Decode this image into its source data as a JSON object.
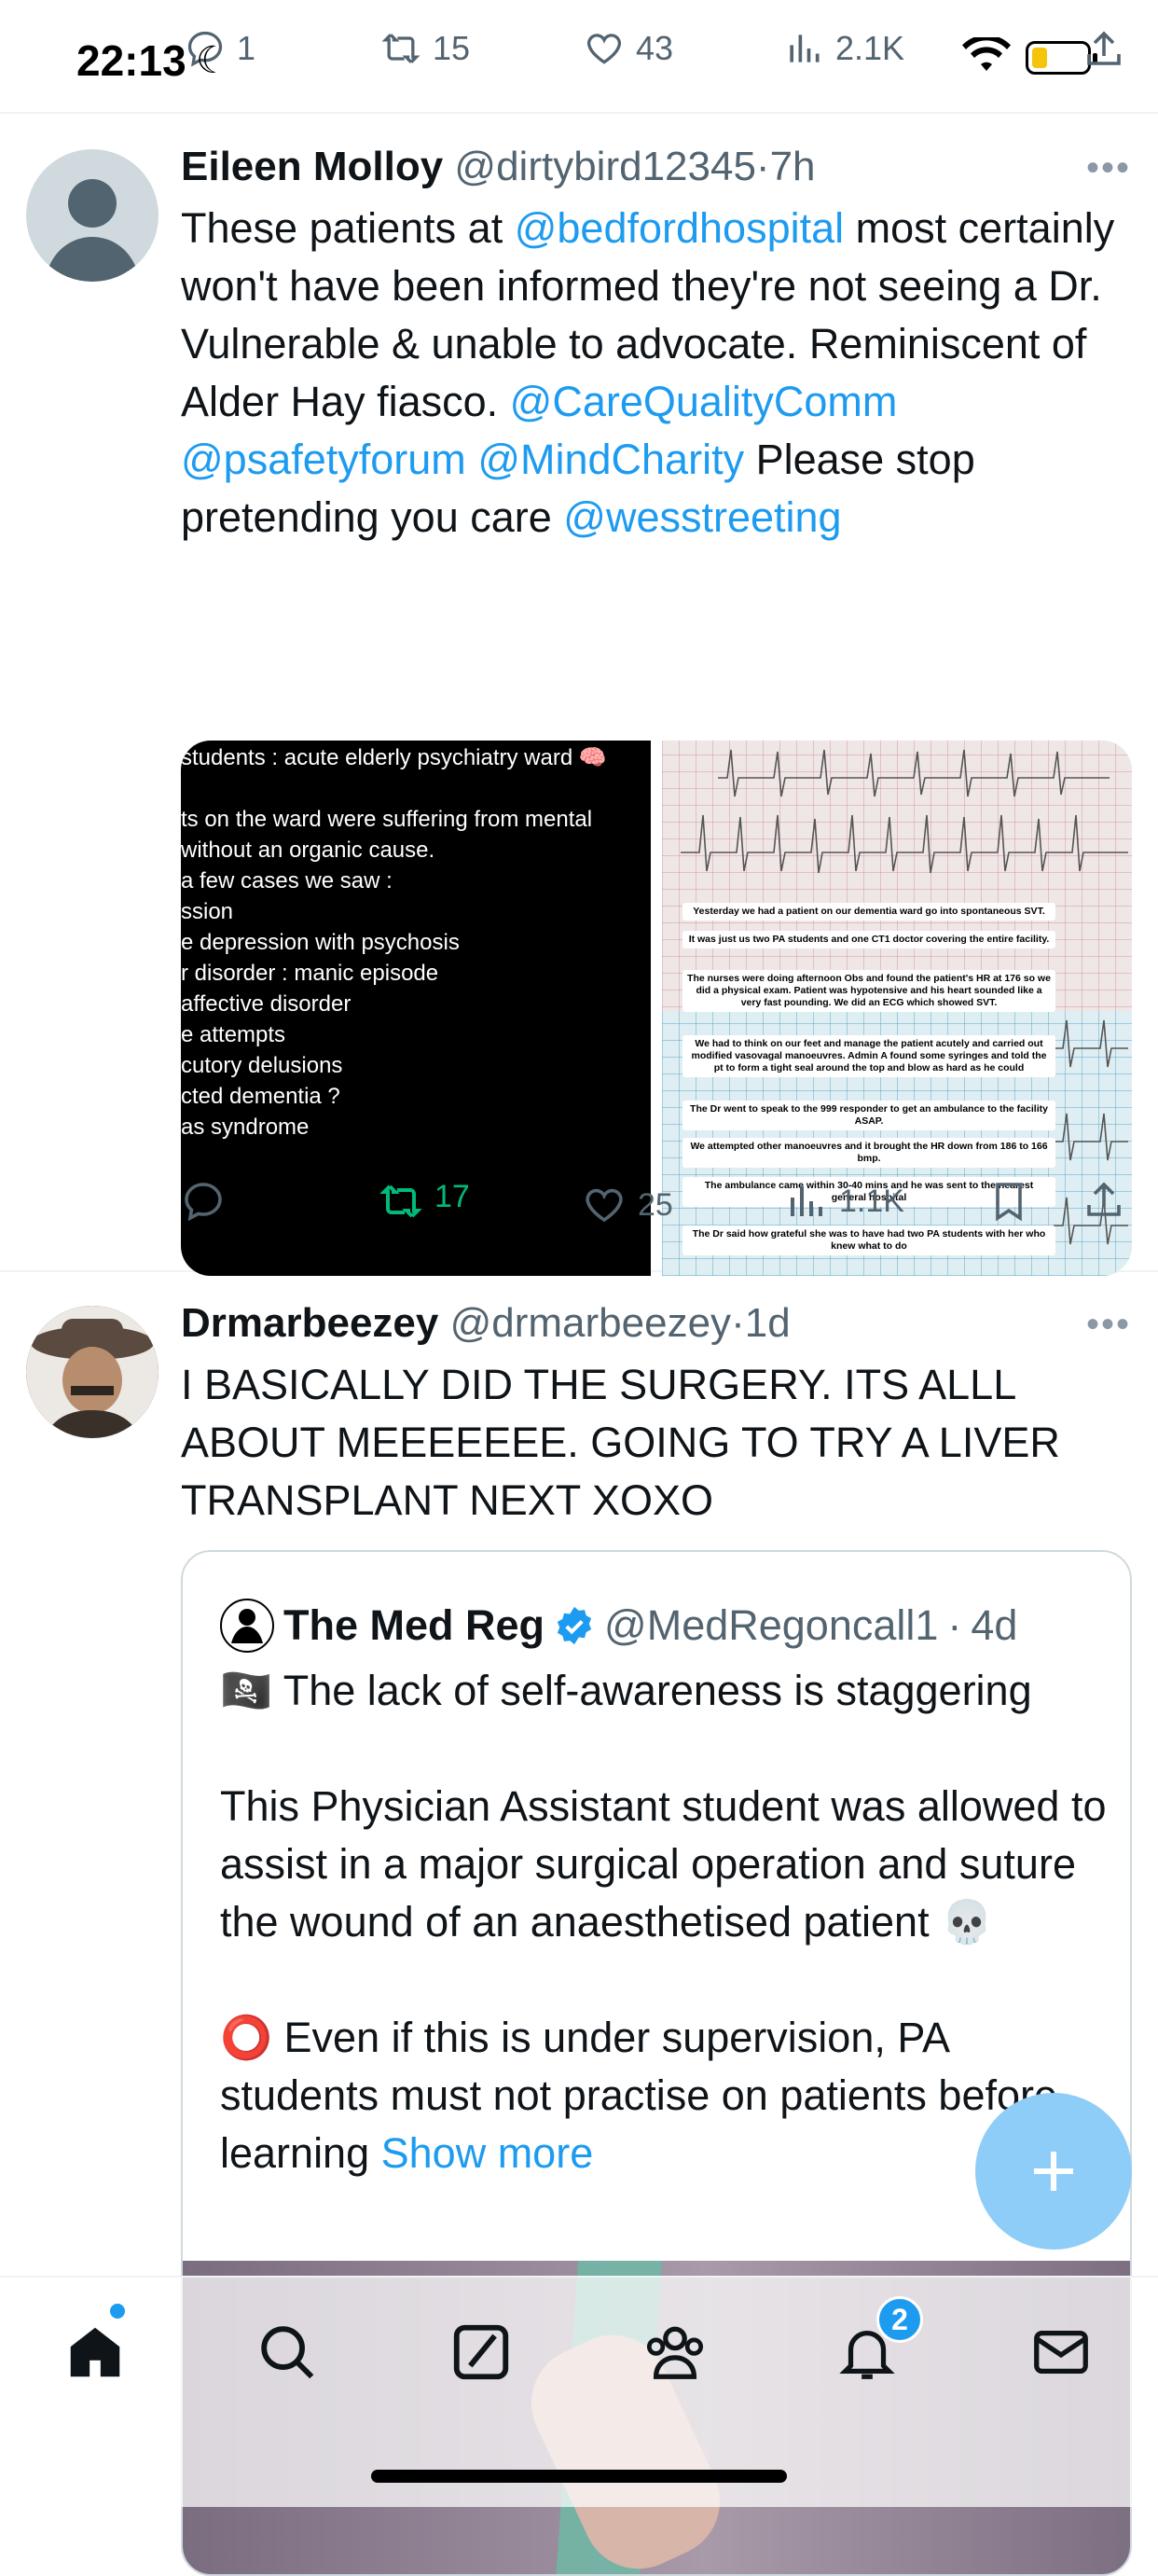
{
  "status_bar": {
    "time": "22:13"
  },
  "top_actions": {
    "replies": "1",
    "retweets": "15",
    "likes": "43",
    "views": "2.1K"
  },
  "tweets": [
    {
      "name": "Eileen Molloy",
      "handle": "@dirtybird12345",
      "time": "7h",
      "body": {
        "p1": "These patients at ",
        "mention1": "@bedfordhospital",
        "p2": " most certainly won't have been informed they're not seeing a Dr. Vulnerable & unable to advocate. Reminiscent of Alder Hay fiasco. ",
        "mention2": "@CareQualityComm",
        "mention3": "@psafetyforum",
        "mention4": "@MindCharity",
        "p3": " Please stop pretending you care ",
        "mention5": "@wesstreeting"
      },
      "media_left": [
        "students : acute elderly psychiatry ward 🧠",
        "",
        "ts on the ward were suffering from mental",
        " without an organic cause.",
        " a few cases we saw :",
        "ssion",
        "e depression with psychosis",
        "r disorder : manic episode",
        "affective disorder",
        "e attempts",
        "cutory delusions",
        "cted dementia ?",
        "as syndrome"
      ],
      "media_right_captions": [
        "Yesterday we had a patient on our dementia ward go into spontaneous SVT.",
        "It was just us two PA students and one CT1 doctor covering the entire facility.",
        "The nurses were doing afternoon Obs and found the patient's HR at 176 so we did a physical exam. Patient was hypotensive and his heart sounded like a very fast pounding. We did an ECG which showed SVT.",
        "We had to think on our feet and manage the patient acutely and carried out modified vasovagal manoeuvres. Admin A found some syringes and told the pt to form a tight seal around the top and blow as hard as he could",
        "The Dr went to speak to the 999 responder to get an ambulance to the facility ASAP.",
        "We attempted other manoeuvres and it brought the HR down from 186 to 166 bmp.",
        "The ambulance came within 30-40 mins and he was sent to the nearest general hospital",
        "The Dr said how grateful she was to have had two PA students with her who knew what to do"
      ],
      "actions": {
        "replies": "",
        "retweets": "17",
        "likes": "25",
        "views": "1.1K"
      }
    },
    {
      "name": "Drmarbeezey",
      "handle": "@drmarbeezey",
      "time": "1d",
      "body": "I BASICALLY DID THE SURGERY. ITS ALLL ABOUT MEEEEEEE. GOING TO TRY A LIVER TRANSPLANT NEXT XOXO",
      "quote": {
        "name": "The Med Reg",
        "handle": "@MedRegoncall1",
        "time": "4d",
        "line1": "🏴‍☠️ The lack of self-awareness is staggering",
        "line2": "This Physician Assistant student was allowed to assist in a major surgical operation and suture the wound of an anaesthetised patient 💀",
        "line3": "⭕ Even if this is under supervision, PA students must not practise on patients before learning ",
        "show_more": "Show more"
      }
    }
  ],
  "tab_bar": {
    "notifications_badge": "2"
  },
  "colors": {
    "accent": "#1d9bf0",
    "retweet_active": "#00ba7c",
    "text": "#0f1419",
    "secondary": "#536471"
  }
}
